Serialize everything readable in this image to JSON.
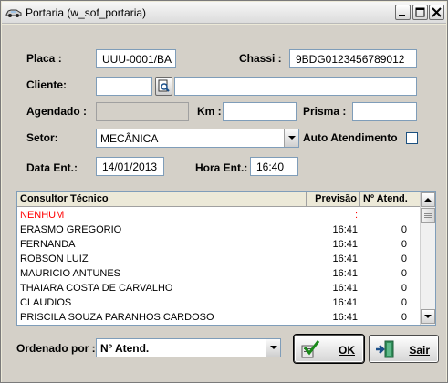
{
  "window": {
    "title": "Portaria (w_sof_portaria)"
  },
  "form": {
    "placa_label": "Placa :",
    "placa_value": "UUU-0001/BA",
    "chassi_label": "Chassi :",
    "chassi_value": "9BDG0123456789012",
    "cliente_label": "Cliente:",
    "cliente_code": "",
    "cliente_name": "",
    "agendado_label": "Agendado :",
    "agendado_value": "",
    "km_label": "Km :",
    "km_value": "",
    "prisma_label": "Prisma :",
    "prisma_value": "",
    "setor_label": "Setor:",
    "setor_value": "MECÂNICA",
    "auto_label": "Auto Atendimento",
    "auto_checked": false,
    "data_ent_label": "Data Ent.:",
    "data_ent_value": "14/01/2013",
    "hora_ent_label": "Hora Ent.:",
    "hora_ent_value": "16:40"
  },
  "grid": {
    "headers": [
      "Consultor Técnico",
      "Previsão",
      "Nº Atend."
    ],
    "rows": [
      {
        "name": "NENHUM",
        "previsao": ":",
        "atend": "",
        "highlight": true
      },
      {
        "name": "ERASMO GREGORIO",
        "previsao": "16:41",
        "atend": "0"
      },
      {
        "name": "FERNANDA",
        "previsao": "16:41",
        "atend": "0"
      },
      {
        "name": "ROBSON LUIZ",
        "previsao": "16:41",
        "atend": "0"
      },
      {
        "name": "MAURICIO ANTUNES",
        "previsao": "16:41",
        "atend": "0"
      },
      {
        "name": "THAIARA COSTA DE CARVALHO",
        "previsao": "16:41",
        "atend": "0"
      },
      {
        "name": "CLAUDIOS",
        "previsao": "16:41",
        "atend": "0"
      },
      {
        "name": "PRISCILA SOUZA PARANHOS CARDOSO",
        "previsao": "16:41",
        "atend": "0"
      }
    ]
  },
  "footer": {
    "ordenado_label": "Ordenado por :",
    "ordenado_value": "Nº Atend.",
    "ok_label": "OK",
    "sair_label": "Sair"
  },
  "colors": {
    "highlight_text": "#ff0000",
    "accent": "#7f9db9"
  },
  "icons": {
    "app": "car-icon",
    "lookup": "lookup-icon",
    "ok": "check-icon",
    "sair": "exit-door-icon"
  }
}
